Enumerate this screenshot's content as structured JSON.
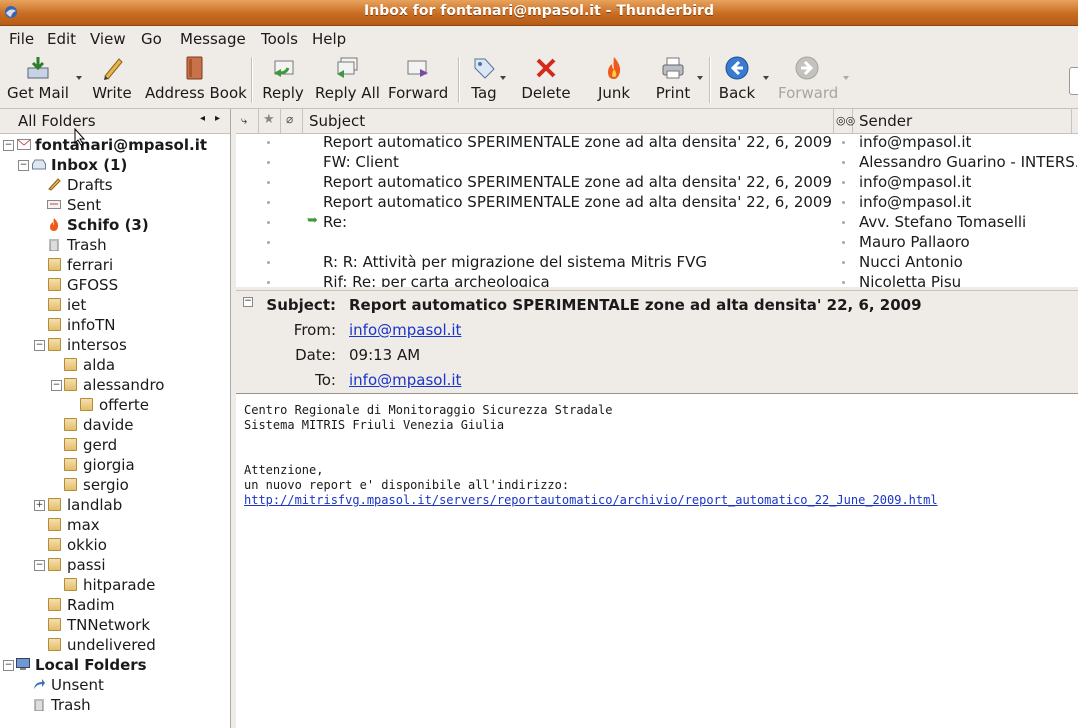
{
  "window": {
    "title": "Inbox for fontanari@mpasol.it - Thunderbird"
  },
  "menu": [
    "File",
    "Edit",
    "View",
    "Go",
    "Message",
    "Tools",
    "Help"
  ],
  "toolbar": {
    "get_mail": "Get Mail",
    "write": "Write",
    "address_book": "Address Book",
    "reply": "Reply",
    "reply_all": "Reply All",
    "forward": "Forward",
    "tag": "Tag",
    "delete": "Delete",
    "junk": "Junk",
    "print": "Print",
    "back": "Back",
    "forward_nav": "Forward"
  },
  "folders": {
    "header": "All Folders",
    "account": "fontanari@mpasol.it",
    "inbox": "Inbox (1)",
    "drafts": "Drafts",
    "sent": "Sent",
    "schifo": "Schifo (3)",
    "trash": "Trash",
    "ferrari": "ferrari",
    "gfoss": "GFOSS",
    "iet": "iet",
    "infotn": "infoTN",
    "intersos": "intersos",
    "alda": "alda",
    "alessandro": "alessandro",
    "offerte": "offerte",
    "davide": "davide",
    "gerd": "gerd",
    "giorgia": "giorgia",
    "sergio": "sergio",
    "landlab": "landlab",
    "max": "max",
    "okkio": "okkio",
    "passi": "passi",
    "hitparade": "hitparade",
    "radim": "Radim",
    "tnnetwork": "TNNetwork",
    "undelivered": "undelivered",
    "local_folders": "Local Folders",
    "unsent": "Unsent",
    "local_trash": "Trash"
  },
  "thread": {
    "col_subject": "Subject",
    "col_sender": "Sender",
    "messages": [
      {
        "subject": "Report automatico SPERIMENTALE zone ad alta densita' 22, 6, 2009",
        "sender": "info@mpasol.it",
        "replied": false
      },
      {
        "subject": "FW: Client",
        "sender": "Alessandro Guarino - INTERS...",
        "replied": false
      },
      {
        "subject": "Report automatico SPERIMENTALE zone ad alta densita' 22, 6, 2009",
        "sender": "info@mpasol.it",
        "replied": false
      },
      {
        "subject": "Report automatico SPERIMENTALE zone ad alta densita' 22, 6, 2009",
        "sender": "info@mpasol.it",
        "replied": false
      },
      {
        "subject": "Re:",
        "sender": "Avv. Stefano Tomaselli",
        "replied": true
      },
      {
        "subject": "",
        "sender": "Mauro Pallaoro",
        "replied": false
      },
      {
        "subject": "R: R: Attività per migrazione del sistema Mitris FVG",
        "sender": "Nucci Antonio",
        "replied": false
      },
      {
        "subject": "Rif: Re: per carta archeologica",
        "sender": "Nicoletta Pisu",
        "replied": false
      }
    ]
  },
  "header": {
    "subject_label": "Subject:",
    "subject": "Report automatico SPERIMENTALE zone ad alta densita' 22, 6, 2009",
    "from_label": "From:",
    "from": "info@mpasol.it",
    "date_label": "Date:",
    "date": "09:13 AM",
    "to_label": "To:",
    "to": "info@mpasol.it"
  },
  "body": {
    "line1": "Centro Regionale di Monitoraggio Sicurezza Stradale",
    "line2": "Sistema MITRIS Friuli Venezia Giulia",
    "line3": "Attenzione,",
    "line4": "un nuovo report e' disponibile all'indirizzo:",
    "link": "http://mitrisfvg.mpasol.it/servers/reportautomatico/archivio/report_automatico_22_June_2009.html"
  }
}
